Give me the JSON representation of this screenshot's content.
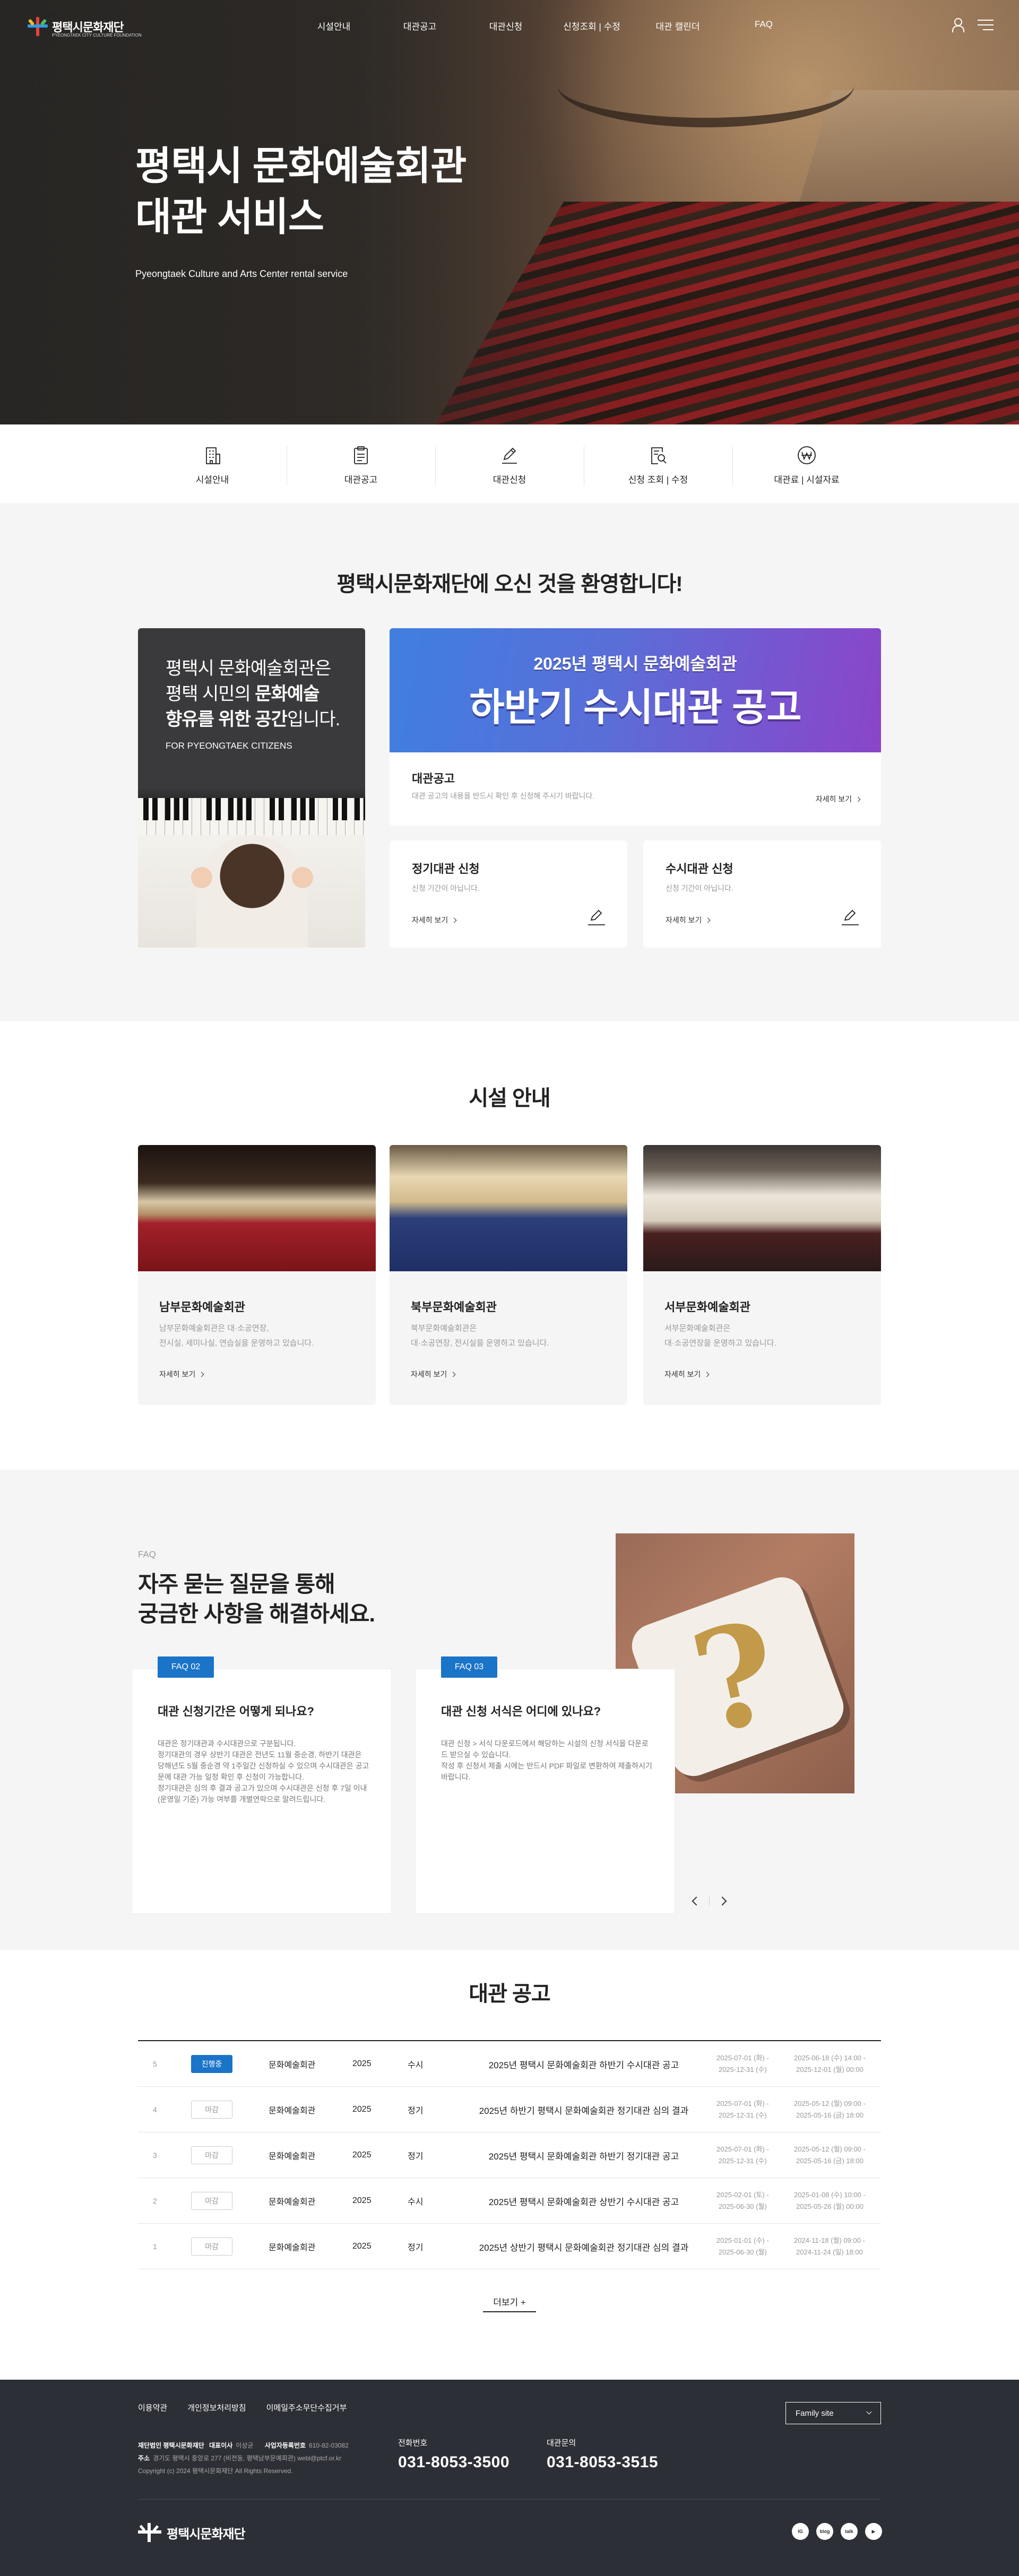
{
  "header": {
    "logo_text": "평택시문화재단",
    "logo_sub": "PYEONGTAEK CITY CULTURE FOUNDATION",
    "menu": [
      "시설안내",
      "대관공고",
      "대관신청",
      "신청조회 | 수정",
      "대관 캘린더",
      "FAQ"
    ]
  },
  "hero": {
    "title_line1": "평택시 문화예술회관",
    "title_line2": "대관 서비스",
    "subtitle": "Pyeongtaek Culture and Arts Center rental service"
  },
  "quick_menu": [
    {
      "label": "시설안내",
      "icon": "building-icon"
    },
    {
      "label": "대관공고",
      "icon": "clipboard-icon"
    },
    {
      "label": "대관신청",
      "icon": "pencil-icon"
    },
    {
      "label": "신청 조회 | 수정",
      "icon": "document-search-icon"
    },
    {
      "label": "대관료 | 시설자료",
      "icon": "won-icon"
    }
  ],
  "welcome": {
    "title": "평택시문화재단에 오신 것을 환영합니다!",
    "intro_line1": "평택시 문화예술회관은",
    "intro_line2a": "평택 시민의 ",
    "intro_line2b": "문화예술",
    "intro_line3a": "향유를 위한 공간",
    "intro_line3b": "입니다.",
    "intro_eng": "FOR PYEONGTAEK CITIZENS",
    "banner_sub": "2025년 평택시 문화예술회관",
    "banner_main": "하반기 수시대관 공고",
    "notice_title": "대관공고",
    "notice_desc": "대관 공고의 내용을 반드시 확인 후 신청해 주시기 바랍니다.",
    "more": "자세히 보기",
    "regular_title": "정기대관 신청",
    "regular_desc": "신청 기간이 아닙니다.",
    "occasional_title": "수시대관 신청",
    "occasional_desc": "신청 기간이 아닙니다."
  },
  "facility": {
    "title": "시설 안내",
    "items": [
      {
        "name": "남부문화예술회관",
        "desc1": "남부문화예술회관은 대·소공연장,",
        "desc2": "전시실, 세미나실, 연습실을 운영하고 있습니다.",
        "more": "자세히 보기"
      },
      {
        "name": "북부문화예술회관",
        "desc1": "북부문화예술회관은",
        "desc2": "대·소공연장, 전시실을 운영하고 있습니다.",
        "more": "자세히 보기"
      },
      {
        "name": "서부문화예술회관",
        "desc1": "서부문화예술회관은",
        "desc2": "대·소공연장을 운영하고 있습니다.",
        "more": "자세히 보기"
      }
    ]
  },
  "faq": {
    "tag": "FAQ",
    "title_line1": "자주 묻는 질문을 통해",
    "title_line2": "궁금한 사항을 해결하세요.",
    "items": [
      {
        "badge": "FAQ 02",
        "q": "대관 신청기간은 어떻게 되나요?",
        "a": "대관은 정기대관과 수시대관으로 구분됩니다.\n정기대관의 경우 상반기 대관은 전년도 11월 중순경, 하반기 대관은 당해년도 5월 중순경 약 1주일간 신청하실 수 있으며 수시대관은 공고문에 대관 가능 일정 확인 후 신청이 가능합니다.\n정기대관은 심의 후 결과 공고가 있으며 수시대관은 신청 후 7일 이내(운영일 기준) 가능 여부를 개별연락으로 알려드립니다."
      },
      {
        "badge": "FAQ 03",
        "q": "대관 신청 서식은 어디에 있나요?",
        "a": "대관 신청 > 서식 다운로드에서 해당하는 시설의 신청 서식을 다운로드 받으실 수 있습니다.\n작성 후 신청서 제출 시에는 반드시 PDF 파일로 변환하여 제출하시기 바랍니다."
      }
    ]
  },
  "notices": {
    "title": "대관 공고",
    "rows": [
      {
        "num": "5",
        "status": "진행중",
        "active": true,
        "venue": "문화예술회관",
        "year": "2025",
        "kind": "수시",
        "title": "2025년 평택시 문화예술회관 하반기 수시대관 공고",
        "period1a": "2025-07-01 (화) -",
        "period1b": "2025-12-31 (수)",
        "period2a": "2025-06-18 (수) 14:00 -",
        "period2b": "2025-12-01 (월) 00:00"
      },
      {
        "num": "4",
        "status": "마감",
        "active": false,
        "venue": "문화예술회관",
        "year": "2025",
        "kind": "정기",
        "title": "2025년 하반기 평택시 문화예술회관 정기대관 심의 결과",
        "period1a": "2025-07-01 (화) -",
        "period1b": "2025-12-31 (수)",
        "period2a": "2025-05-12 (월) 09:00 -",
        "period2b": "2025-05-16 (금) 18:00"
      },
      {
        "num": "3",
        "status": "마감",
        "active": false,
        "venue": "문화예술회관",
        "year": "2025",
        "kind": "정기",
        "title": "2025년 평택시 문화예술회관 하반기 정기대관 공고",
        "period1a": "2025-07-01 (화) -",
        "period1b": "2025-12-31 (수)",
        "period2a": "2025-05-12 (월) 09:00 -",
        "period2b": "2025-05-16 (금) 18:00"
      },
      {
        "num": "2",
        "status": "마감",
        "active": false,
        "venue": "문화예술회관",
        "year": "2025",
        "kind": "수시",
        "title": "2025년 평택시 문화예술회관 상반기 수시대관 공고",
        "period1a": "2025-02-01 (토) -",
        "period1b": "2025-06-30 (월)",
        "period2a": "2025-01-08 (수) 10:00 -",
        "period2b": "2025-05-26 (월) 00:00"
      },
      {
        "num": "1",
        "status": "마감",
        "active": false,
        "venue": "문화예술회관",
        "year": "2025",
        "kind": "정기",
        "title": "2025년 상반기 평택시 문화예술회관 정기대관 심의 결과",
        "period1a": "2025-01-01 (수) -",
        "period1b": "2025-06-30 (월)",
        "period2a": "2024-11-18 (월) 09:00 -",
        "period2b": "2024-11-24 (일) 18:00"
      }
    ],
    "more": "더보기 +"
  },
  "footer": {
    "links": [
      "이용약관",
      "개인정보처리방침",
      "이메일주소무단수집거부"
    ],
    "family_site": "Family site",
    "org_label": "재단법인 평택시문화재단",
    "ceo_label": "대표이사",
    "ceo": "이상균",
    "biz_label": "사업자등록번호",
    "biz": "610-82-03082",
    "addr_label": "주소",
    "addr": "경기도 평택시 중앙로 277 (비전동, 평택남부문예회관) webl@ptcf.or.kr",
    "copyright": "Copyright (c) 2024 평택시문화재단 All Rights Reserved.",
    "tel_label": "전화번호",
    "tel": "031-8053-3500",
    "inquiry_label": "대관문의",
    "inquiry": "031-8053-3515",
    "logo_text": "평택시문화재단",
    "sns": [
      "instagram-icon",
      "blog-icon",
      "kakao-icon",
      "youtube-icon"
    ],
    "sns_labels": [
      "IG",
      "blog",
      "talk",
      "▶"
    ]
  }
}
